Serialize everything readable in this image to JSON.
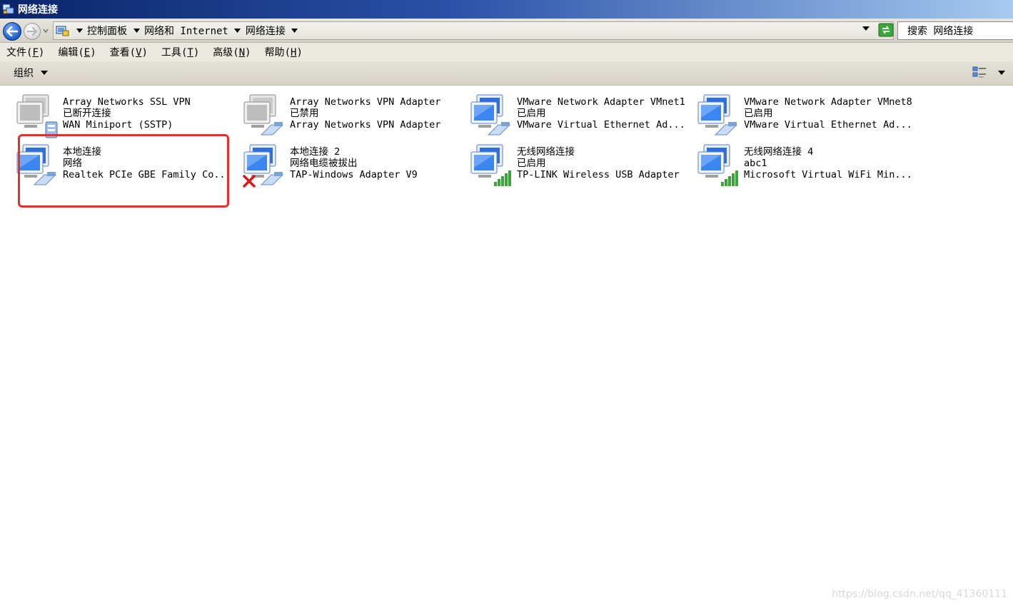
{
  "window": {
    "title": "网络连接",
    "title_icon": "network-connections-icon"
  },
  "nav": {
    "back_icon": "back-arrow-icon",
    "forward_icon": "forward-arrow-icon"
  },
  "address": {
    "crumbs": [
      {
        "label": "控制面板"
      },
      {
        "label": "网络和 Internet"
      },
      {
        "label": "网络连接"
      }
    ],
    "refresh_icon": "refresh-icon"
  },
  "search": {
    "placeholder": "搜索 网络连接"
  },
  "menu": {
    "items": [
      {
        "label": "文件",
        "accel": "F"
      },
      {
        "label": "编辑",
        "accel": "E"
      },
      {
        "label": "查看",
        "accel": "V"
      },
      {
        "label": "工具",
        "accel": "T"
      },
      {
        "label": "高级",
        "accel": "N"
      },
      {
        "label": "帮助",
        "accel": "H"
      }
    ]
  },
  "command": {
    "organize_label": "组织",
    "views_icon": "views-icon"
  },
  "connections": [
    {
      "name": "Array Networks SSL VPN",
      "status": "已断开连接",
      "device": "WAN Miniport (SSTP)",
      "kind": "vpn-disconnected"
    },
    {
      "name": "Array Networks VPN Adapter",
      "status": "已禁用",
      "device": "Array Networks VPN Adapter",
      "kind": "disabled"
    },
    {
      "name": "VMware Network Adapter VMnet1",
      "status": "已启用",
      "device": "VMware Virtual Ethernet Ad...",
      "kind": "enabled"
    },
    {
      "name": "VMware Network Adapter VMnet8",
      "status": "已启用",
      "device": "VMware Virtual Ethernet Ad...",
      "kind": "enabled"
    },
    {
      "name": "本地连接",
      "status": "网络",
      "device": "Realtek PCIe GBE Family Co...",
      "kind": "connected"
    },
    {
      "name": "本地连接 2",
      "status": "网络电缆被拔出",
      "device": "TAP-Windows Adapter V9",
      "kind": "unplugged"
    },
    {
      "name": "无线网络连接",
      "status": "已启用",
      "device": "TP-LINK Wireless USB Adapter",
      "kind": "wireless"
    },
    {
      "name": "无线网络连接 4",
      "status": "abc1",
      "device": "Microsoft Virtual WiFi Min...",
      "kind": "wireless"
    }
  ],
  "watermark": "https://blog.csdn.net/qq_41360111",
  "colors": {
    "highlight": "#ee2b2b",
    "title_start": "#0a246a",
    "title_end": "#a6caf0"
  }
}
